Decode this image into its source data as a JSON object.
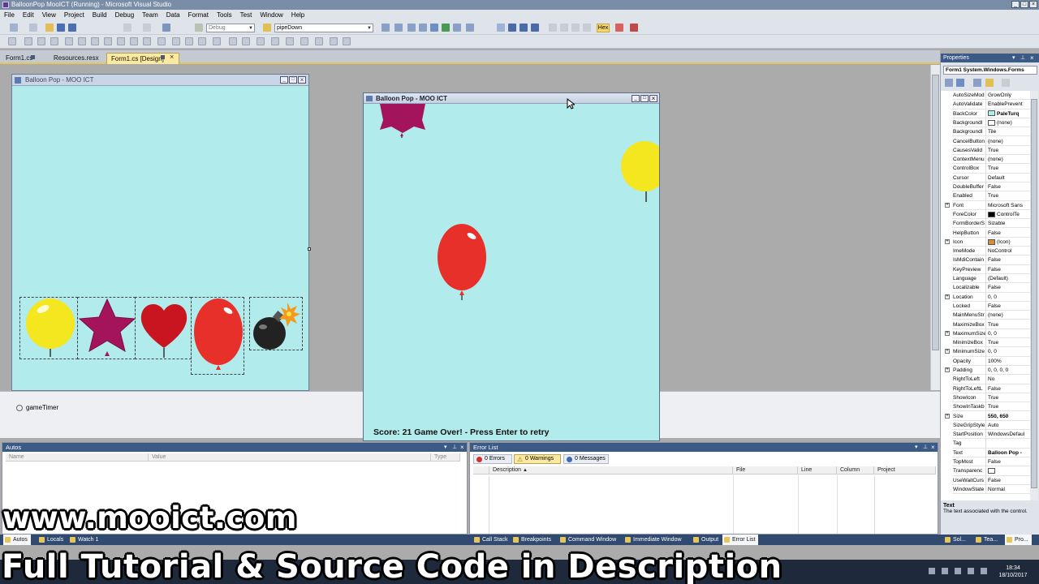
{
  "window": {
    "title": "BalloonPop MooICT (Running) - Microsoft Visual Studio"
  },
  "menu": [
    "File",
    "Edit",
    "View",
    "Project",
    "Build",
    "Debug",
    "Team",
    "Data",
    "Format",
    "Tools",
    "Test",
    "Window",
    "Help"
  ],
  "toolbar": {
    "config": "Debug",
    "find": "pipeDown",
    "hex_label": "Hex"
  },
  "doc_tabs": [
    "Form1.cs",
    "Resources.resx",
    "Form1.cs [Design]"
  ],
  "designer": {
    "form_title": "Balloon Pop - MOO ICT",
    "tray_component": "gameTimer"
  },
  "game": {
    "title": "Balloon Pop - MOO ICT",
    "status": "Score: 21  Game Over! -  Press Enter to retry"
  },
  "properties": {
    "panel_title": "Properties",
    "object": "Form1 System.Windows.Forms",
    "rows": [
      {
        "name": "AutoSizeMod",
        "value": "GrowOnly"
      },
      {
        "name": "AutoValidate",
        "value": "EnablePrevent"
      },
      {
        "name": "BackColor",
        "value": "PaleTurq",
        "swatch": "#afeeee",
        "bold": true
      },
      {
        "name": "BackgroundI",
        "value": "(none)",
        "swatch": "#ffffff"
      },
      {
        "name": "BackgroundI",
        "value": "Tile"
      },
      {
        "name": "CancelButton",
        "value": "(none)"
      },
      {
        "name": "CausesValid",
        "value": "True"
      },
      {
        "name": "ContextMenu",
        "value": "(none)"
      },
      {
        "name": "ControlBox",
        "value": "True"
      },
      {
        "name": "Cursor",
        "value": "Default"
      },
      {
        "name": "DoubleBuffer",
        "value": "False"
      },
      {
        "name": "Enabled",
        "value": "True"
      },
      {
        "name": "Font",
        "value": "Microsoft Sans",
        "plus": true
      },
      {
        "name": "ForeColor",
        "value": "ControlTe",
        "swatch": "#000000"
      },
      {
        "name": "FormBorderS",
        "value": "Sizable"
      },
      {
        "name": "HelpButton",
        "value": "False"
      },
      {
        "name": "Icon",
        "value": "(Icon)",
        "plus": true,
        "swatch": "#d98c3a"
      },
      {
        "name": "ImeMode",
        "value": "NoControl"
      },
      {
        "name": "IsMdiContain",
        "value": "False"
      },
      {
        "name": "KeyPreview",
        "value": "False"
      },
      {
        "name": "Language",
        "value": "(Default)"
      },
      {
        "name": "Localizable",
        "value": "False"
      },
      {
        "name": "Location",
        "value": "0, 0",
        "plus": true
      },
      {
        "name": "Locked",
        "value": "False"
      },
      {
        "name": "MainMenuStr",
        "value": "(none)"
      },
      {
        "name": "MaximizeBox",
        "value": "True"
      },
      {
        "name": "MaximumSize",
        "value": "0, 0",
        "plus": true
      },
      {
        "name": "MinimizeBox",
        "value": "True"
      },
      {
        "name": "MinimumSize",
        "value": "0, 0",
        "plus": true
      },
      {
        "name": "Opacity",
        "value": "100%"
      },
      {
        "name": "Padding",
        "value": "0, 0, 0, 0",
        "plus": true
      },
      {
        "name": "RightToLeft",
        "value": "No"
      },
      {
        "name": "RightToLeftL",
        "value": "False"
      },
      {
        "name": "ShowIcon",
        "value": "True"
      },
      {
        "name": "ShowInTaskb",
        "value": "True"
      },
      {
        "name": "Size",
        "value": "550, 650",
        "plus": true,
        "bold": true
      },
      {
        "name": "SizeGripStyle",
        "value": "Auto"
      },
      {
        "name": "StartPosition",
        "value": "WindowsDefaul"
      },
      {
        "name": "Tag",
        "value": ""
      },
      {
        "name": "Text",
        "value": "Balloon Pop -",
        "bold": true
      },
      {
        "name": "TopMost",
        "value": "False"
      },
      {
        "name": "Transparenc",
        "value": "",
        "swatch": "#ffffff"
      },
      {
        "name": "UseWaitCurs",
        "value": "False"
      },
      {
        "name": "WindowState",
        "value": "Normal"
      }
    ],
    "desc_title": "Text",
    "desc_body": "The text associated with the control."
  },
  "autos": {
    "title": "Autos",
    "cols": [
      "Name",
      "Value",
      "Type"
    ]
  },
  "errors": {
    "title": "Error List",
    "btn_errors": "0 Errors",
    "btn_warnings": "0 Warnings",
    "btn_messages": "0 Messages",
    "cols": [
      "Description",
      "File",
      "Line",
      "Column",
      "Project"
    ]
  },
  "bottom_tabs_left": [
    "Autos",
    "Locals",
    "Watch 1"
  ],
  "bottom_tabs_right": [
    "Call Stack",
    "Breakpoints",
    "Command Window",
    "Immediate Window",
    "Output",
    "Error List"
  ],
  "side_tabs": [
    "Sol...",
    "Tea...",
    "Pro..."
  ],
  "clock": {
    "time": "18:34",
    "date": "18/10/2017"
  },
  "overlay": {
    "line1": "www.mooict.com",
    "line2": "Full Tutorial & Source Code in Description"
  }
}
